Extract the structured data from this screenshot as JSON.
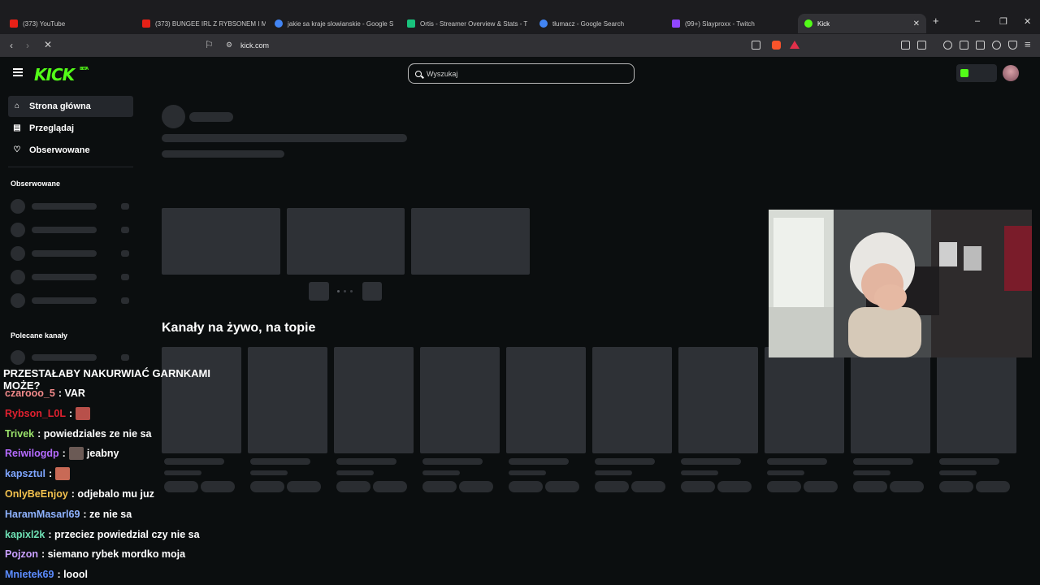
{
  "browser": {
    "tabs": [
      {
        "label": "(373) YouTube",
        "color": "#e62117",
        "active": false
      },
      {
        "label": "(373) BUNGEE IRL Z RYBSONEM I MI",
        "color": "#e62117",
        "active": false
      },
      {
        "label": "jakie sa kraje slowianskie - Google S",
        "color": "#4285f4",
        "active": false
      },
      {
        "label": "Ortis - Streamer Overview & Stats - T",
        "color": "#19c37d",
        "active": false
      },
      {
        "label": "tłumacz - Google Search",
        "color": "#4285f4",
        "active": false
      },
      {
        "label": "(99+) Slayproxx - Twitch",
        "color": "#9146ff",
        "active": false
      },
      {
        "label": "Kick",
        "color": "#53fc18",
        "active": true
      }
    ],
    "new_tab": "+",
    "window_controls": [
      "–",
      "❐",
      "✕"
    ],
    "url": "kick.com"
  },
  "kick": {
    "logo": "KICK",
    "logo_badge": "BETA",
    "search": {
      "placeholder": "Wyszukaj"
    },
    "sidebar": {
      "items": [
        {
          "label": "Strona główna",
          "icon": "home-icon",
          "active": true
        },
        {
          "label": "Przeglądaj",
          "icon": "browse-icon",
          "active": false
        },
        {
          "label": "Obserwowane",
          "icon": "heart-icon",
          "active": false
        }
      ],
      "followed_heading": "Obserwowane",
      "recommended_heading": "Polecane kanały"
    },
    "live_section_title": "Kanały na żywo, na topie"
  },
  "stream_chat": {
    "top_message": "PRZESTAŁABY NAKURWIAĆ GARNKAMI MOŻE?",
    "messages": [
      {
        "user": "czarooo_5",
        "color": "#f28a8a",
        "text": ": VAR",
        "emote": false
      },
      {
        "user": "Rybson_L0L",
        "color": "#e0202f",
        "text": ":",
        "emote": true
      },
      {
        "user": "Trivek",
        "color": "#9be36b",
        "text": ": powiedziales ze nie sa",
        "emote": false
      },
      {
        "user": "Reiwilogdp",
        "color": "#b56bff",
        "text": "jeabny",
        "emote": true
      },
      {
        "user": "kapsztul",
        "color": "#7fa6ff",
        "text": ":",
        "emote": true
      },
      {
        "user": "OnlyBeEnjoy",
        "color": "#f2c14e",
        "text": ": odjebalo mu juz",
        "emote": false
      },
      {
        "user": "HaramMasarl69",
        "color": "#8fb3ff",
        "text": ": ze nie sa",
        "emote": false
      },
      {
        "user": "kapixl2k",
        "color": "#6ee0b4",
        "text": ": przeciez powiedzial czy nie sa",
        "emote": false
      },
      {
        "user": "Pojzon",
        "color": "#c9a0ff",
        "text": ": siemano rybek mordko moja",
        "emote": false
      },
      {
        "user": "Mnietek69",
        "color": "#5c8cff",
        "text": ": loool",
        "emote": false
      }
    ]
  }
}
